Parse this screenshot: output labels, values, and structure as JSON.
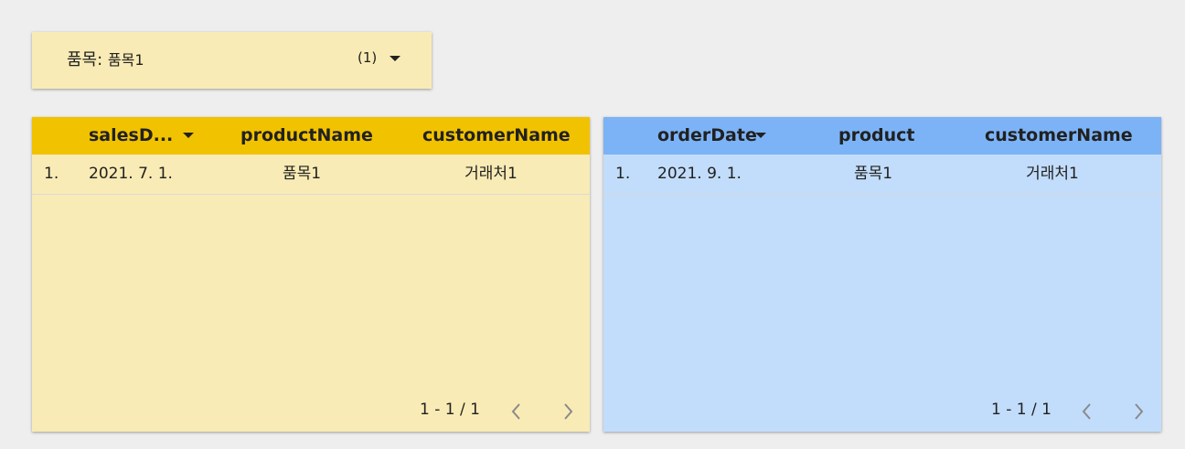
{
  "filter": {
    "label": "품목",
    "separator": ": ",
    "value": "품목1",
    "count": "(1)",
    "caret_icon": "dropdown-caret-icon"
  },
  "table_left": {
    "header_color": "#f1c200",
    "body_color": "#f9ebb5",
    "columns": [
      "salesD...",
      "productName",
      "customerName"
    ],
    "sorted_column": "salesD...",
    "rows": [
      {
        "index": "1.",
        "cells": [
          "2021. 7. 1.",
          "품목1",
          "거래처1"
        ]
      }
    ],
    "pagination": "1 - 1 / 1"
  },
  "table_right": {
    "header_color": "#7cb3f6",
    "body_color": "#c2ddfb",
    "columns": [
      "orderDate",
      "product",
      "customerName"
    ],
    "sorted_column": "orderDate",
    "rows": [
      {
        "index": "1.",
        "cells": [
          "2021. 9. 1.",
          "품목1",
          "거래처1"
        ]
      }
    ],
    "pagination": "1 - 1 / 1"
  }
}
